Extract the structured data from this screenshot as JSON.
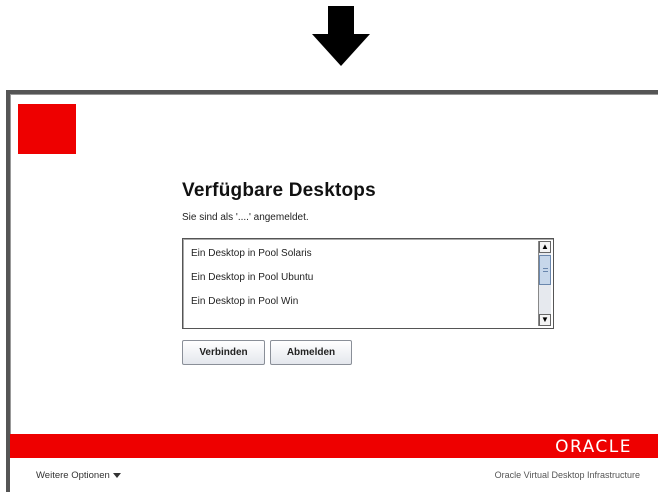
{
  "page": {
    "title": "Verfügbare Desktops",
    "subtitle": "Sie sind als '....' angemeldet."
  },
  "desktops": [
    {
      "label": "Ein Desktop in Pool Solaris"
    },
    {
      "label": "Ein Desktop in Pool Ubuntu"
    },
    {
      "label": "Ein Desktop in Pool Win"
    }
  ],
  "buttons": {
    "connect": "Verbinden",
    "logout": "Abmelden"
  },
  "footer": {
    "more_options": "Weitere Optionen",
    "brand": "ORACLE",
    "product": "Oracle Virtual Desktop Infrastructure"
  },
  "colors": {
    "brand_red": "#ee0000"
  },
  "icons": {
    "arrow": "arrow-down-icon",
    "scroll_up": "scroll-up-icon",
    "scroll_down": "scroll-down-icon",
    "dropdown": "caret-down-icon"
  }
}
